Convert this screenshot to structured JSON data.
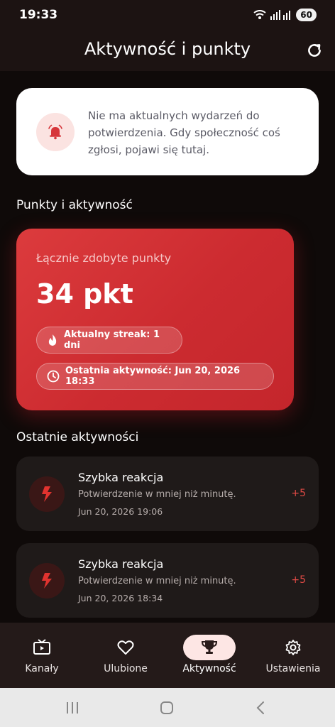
{
  "status_bar": {
    "time": "19:33",
    "battery": "60"
  },
  "header": {
    "title": "Aktywność i punkty"
  },
  "info_card": {
    "text": "Nie ma aktualnych wydarzeń do potwierdzenia. Gdy społeczność coś zgłosi, pojawi się tutaj."
  },
  "points_section": {
    "title": "Punkty i aktywność",
    "label": "Łącznie zdobyte punkty",
    "value": "34 pkt",
    "streak": "Aktualny streak: 1 dni",
    "last_activity": "Ostatnia aktywność: Jun 20, 2026 18:33"
  },
  "recent": {
    "title": "Ostatnie aktywności",
    "items": [
      {
        "title": "Szybka reakcja",
        "desc": "Potwierdzenie w mniej niż minutę.",
        "date": "Jun 20, 2026 19:06",
        "points": "+5"
      },
      {
        "title": "Szybka reakcja",
        "desc": "Potwierdzenie w mniej niż minutę.",
        "date": "Jun 20, 2026 18:34",
        "points": "+5"
      }
    ]
  },
  "bottom_nav": {
    "items": [
      {
        "label": "Kanały",
        "icon": "tv-icon"
      },
      {
        "label": "Ulubione",
        "icon": "heart-icon"
      },
      {
        "label": "Aktywność",
        "icon": "trophy-icon",
        "active": true
      },
      {
        "label": "Ustawienia",
        "icon": "gear-icon"
      }
    ]
  },
  "colors": {
    "accent": "#d6353a",
    "background": "#0f0a09",
    "card": "#1f1a19"
  }
}
